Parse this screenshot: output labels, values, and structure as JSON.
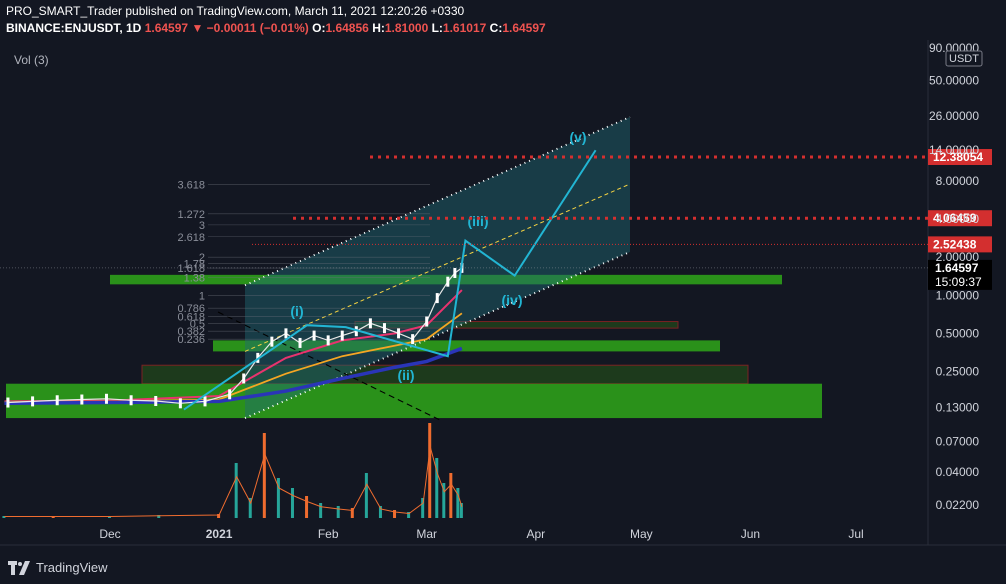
{
  "header": {
    "publisher_line": "PRO_SMART_Trader published on TradingView.com, March 11, 2021 12:20:26 +0330",
    "symbol": "BINANCE:ENJUSDT, 1D",
    "last": "1.64597",
    "change_arrow": "▼",
    "change": "−0.00011 (−0.01%)",
    "o_label": "O:",
    "o_value": "1.64856",
    "h_label": "H:",
    "h_value": "1.81000",
    "l_label": "L:",
    "l_value": "1.61017",
    "c_label": "C:",
    "c_value": "1.64597"
  },
  "volume_label": "Vol (3)",
  "brand": {
    "name": "TradingView",
    "icon": "tradingview-logo-icon"
  },
  "colors": {
    "background": "#131722",
    "price_tag": "#d32f2f",
    "current_price_tag": "#000000",
    "zone_green": "#2e9e1a",
    "zone_dark": "#1d3a1c",
    "wave": "#22b5d3",
    "channel_fill": "#1e6b75",
    "ma_pink": "#e8336e",
    "ma_orange": "#f5a623",
    "ma_blue": "#2a35b8",
    "volume_up": "#26a69a",
    "volume_down": "#ef6c2f"
  },
  "chart_data": {
    "type": "line",
    "scale": "log",
    "currency_badge": "USDT",
    "y_ticks": [
      "90.00000",
      "50.00000",
      "26.00000",
      "14.00000",
      "8.00000",
      "4.00000",
      "2.00000",
      "1.00000",
      "0.50000",
      "0.25000",
      "0.13000",
      "0.07000",
      "0.04000",
      "0.02200"
    ],
    "x_ticks": [
      "Dec",
      "2021",
      "Feb",
      "Mar",
      "Apr",
      "May",
      "Jun",
      "Jul"
    ],
    "price_tags": [
      {
        "label": "12.38054",
        "value": 12.38054
      },
      {
        "label": "4.06459",
        "value": 4.06459
      },
      {
        "label": "2.52438",
        "value": 2.52438
      }
    ],
    "current_price": {
      "label": "1.64597",
      "value": 1.64597,
      "countdown": "15:09:37"
    },
    "fib_levels": [
      {
        "label": "3.618",
        "value": 7.5
      },
      {
        "label": "1.272",
        "value": 4.4
      },
      {
        "label": "3",
        "value": 3.6
      },
      {
        "label": "2.618",
        "value": 2.9
      },
      {
        "label": "2",
        "value": 2.0
      },
      {
        "label": "1.78",
        "value": 1.78
      },
      {
        "label": "1.618",
        "value": 1.64
      },
      {
        "label": "1.38",
        "value": 1.38
      },
      {
        "label": "1",
        "value": 1.0
      },
      {
        "label": "0.786",
        "value": 0.79
      },
      {
        "label": "0.618",
        "value": 0.68
      },
      {
        "label": "0.5",
        "value": 0.6
      },
      {
        "label": "0.382",
        "value": 0.52
      },
      {
        "label": "0.236",
        "value": 0.45
      }
    ],
    "wave_labels": [
      "(i)",
      "(ii)",
      "(iii)",
      "(iv)",
      "(v)"
    ],
    "price_series": {
      "x": [
        "2020-11-02",
        "2020-11-09",
        "2020-11-16",
        "2020-11-23",
        "2020-11-30",
        "2020-12-07",
        "2020-12-14",
        "2020-12-21",
        "2020-12-28",
        "2021-01-04",
        "2021-01-08",
        "2021-01-12",
        "2021-01-16",
        "2021-01-20",
        "2021-01-24",
        "2021-01-28",
        "2021-02-01",
        "2021-02-05",
        "2021-02-09",
        "2021-02-13",
        "2021-02-17",
        "2021-02-21",
        "2021-02-25",
        "2021-03-01",
        "2021-03-04",
        "2021-03-07",
        "2021-03-09",
        "2021-03-11"
      ],
      "y": [
        0.142,
        0.145,
        0.148,
        0.15,
        0.152,
        0.148,
        0.146,
        0.14,
        0.145,
        0.165,
        0.22,
        0.32,
        0.43,
        0.5,
        0.42,
        0.48,
        0.44,
        0.48,
        0.52,
        0.6,
        0.55,
        0.5,
        0.45,
        0.62,
        0.95,
        1.28,
        1.5,
        1.646
      ]
    },
    "wave_projection": {
      "x": [
        "2020-12-22",
        "2021-01-26",
        "2021-02-06",
        "2021-03-07",
        "2021-03-12",
        "2021-03-26",
        "2021-04-18"
      ],
      "y": [
        0.125,
        0.58,
        0.56,
        0.33,
        2.7,
        1.43,
        14.0
      ]
    },
    "moving_averages": [
      {
        "x": [
          "2020-11-01",
          "2020-12-01",
          "2021-01-01",
          "2021-01-20",
          "2021-02-05",
          "2021-02-20",
          "2021-03-01",
          "2021-03-11"
        ],
        "y": [
          0.145,
          0.147,
          0.16,
          0.32,
          0.44,
          0.5,
          0.58,
          1.1
        ]
      },
      {
        "x": [
          "2020-11-01",
          "2020-12-01",
          "2021-01-01",
          "2021-01-20",
          "2021-02-05",
          "2021-02-20",
          "2021-03-01",
          "2021-03-11"
        ],
        "y": [
          0.143,
          0.145,
          0.15,
          0.24,
          0.33,
          0.4,
          0.45,
          0.72
        ]
      },
      {
        "x": [
          "2020-11-01",
          "2020-12-01",
          "2021-01-01",
          "2021-01-20",
          "2021-02-05",
          "2021-02-20",
          "2021-03-01",
          "2021-03-11"
        ],
        "y": [
          0.14,
          0.142,
          0.145,
          0.175,
          0.22,
          0.27,
          0.3,
          0.38
        ]
      }
    ],
    "volume": {
      "x": [
        "2020-11-01",
        "2020-11-15",
        "2020-12-01",
        "2020-12-15",
        "2021-01-01",
        "2021-01-06",
        "2021-01-10",
        "2021-01-14",
        "2021-01-18",
        "2021-01-22",
        "2021-01-26",
        "2021-01-30",
        "2021-02-04",
        "2021-02-08",
        "2021-02-12",
        "2021-02-16",
        "2021-02-20",
        "2021-02-24",
        "2021-02-28",
        "2021-03-02",
        "2021-03-04",
        "2021-03-06",
        "2021-03-08",
        "2021-03-10",
        "2021-03-11"
      ],
      "y": [
        2,
        2,
        2,
        3,
        4,
        55,
        20,
        85,
        40,
        30,
        22,
        15,
        12,
        10,
        45,
        12,
        8,
        6,
        20,
        95,
        60,
        35,
        45,
        30,
        15
      ]
    }
  }
}
